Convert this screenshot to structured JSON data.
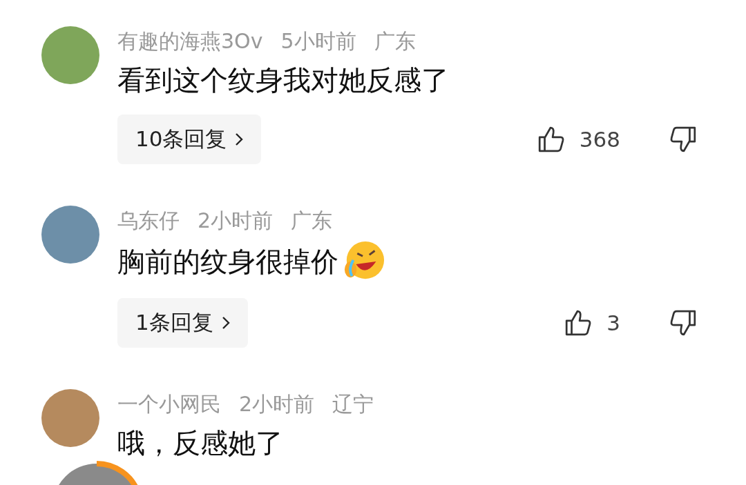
{
  "comments": [
    {
      "name": "有趣的海燕3Ov",
      "time": "5小时前",
      "location": "广东",
      "text": "看到这个纹身我对她反感了",
      "emoji": false,
      "replies": "10条回复",
      "likes": "368"
    },
    {
      "name": "乌东仔",
      "time": "2小时前",
      "location": "广东",
      "text": "胸前的纹身很掉价",
      "emoji": true,
      "replies": "1条回复",
      "likes": "3"
    },
    {
      "name": "一个小网民",
      "time": "2小时前",
      "location": "辽宁",
      "text": "哦，反感她了",
      "emoji": false
    }
  ]
}
